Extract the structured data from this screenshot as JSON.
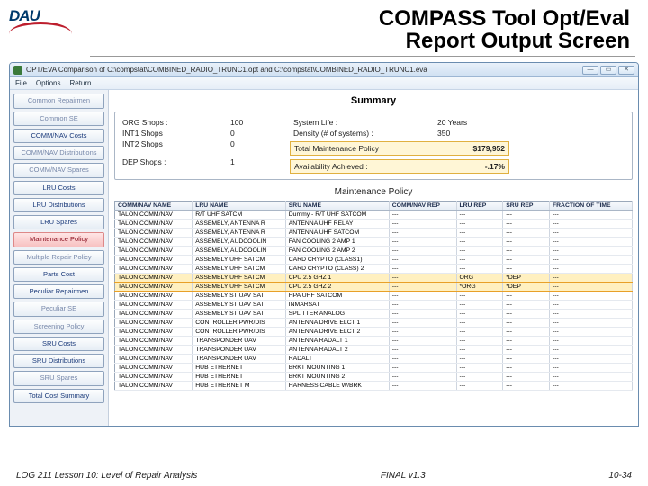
{
  "slide": {
    "title_line1": "COMPASS Tool Opt/Eval",
    "title_line2": "Report Output Screen",
    "logo_text": "DAU"
  },
  "window": {
    "title": "OPT/EVA Comparison of C:\\compstat\\COMBINED_RADIO_TRUNC1.opt and C:\\compstat\\COMBINED_RADIO_TRUNC1.eva"
  },
  "menu": {
    "file": "File",
    "options": "Options",
    "return": "Return"
  },
  "sidebar": {
    "items": [
      {
        "label": "Common Repairmen",
        "dim": true
      },
      {
        "label": "Common SE",
        "dim": true
      },
      {
        "label": "COMM/NAV Costs"
      },
      {
        "label": "COMM/NAV Distributions",
        "dim": true
      },
      {
        "label": "COMM/NAV Spares",
        "dim": true
      },
      {
        "label": "LRU Costs"
      },
      {
        "label": "LRU Distributions"
      },
      {
        "label": "LRU Spares"
      },
      {
        "label": "Maintenance Policy",
        "active": true
      },
      {
        "label": "Multiple Repair Policy",
        "dim": true
      },
      {
        "label": "Parts Cost"
      },
      {
        "label": "Peculiar Repairmen"
      },
      {
        "label": "Peculiar SE",
        "dim": true
      },
      {
        "label": "Screening Policy",
        "dim": true
      },
      {
        "label": "SRU Costs"
      },
      {
        "label": "SRU Distributions"
      },
      {
        "label": "SRU Spares",
        "dim": true
      },
      {
        "label": "Total Cost Summary"
      }
    ]
  },
  "summary": {
    "heading": "Summary",
    "rows": [
      {
        "l1": "ORG Shops :",
        "v1": "100",
        "l2": "System Life :",
        "v2": "20 Years"
      },
      {
        "l1": "INT1 Shops :",
        "v1": "0",
        "l2": "Density (# of systems) :",
        "v2": "350"
      },
      {
        "l1": "INT2 Shops :",
        "v1": "0"
      },
      {
        "l1": "DEP Shops :",
        "v1": "1"
      }
    ],
    "hl1": {
      "label": "Total Maintenance Policy :",
      "value": "$179,952"
    },
    "hl2": {
      "label": "Availability Achieved :",
      "value": "-.17%"
    }
  },
  "policy": {
    "heading": "Maintenance Policy",
    "headers": [
      "COMM/NAV NAME",
      "LRU NAME",
      "SRU NAME",
      "COMM/NAV REP",
      "LRU REP",
      "SRU REP",
      "FRACTION OF TIME"
    ],
    "rows": [
      {
        "c": [
          "TALON COMM/NAV",
          "R/T UHF SATCM",
          "Dummy - R/T UHF SATCOM",
          "---",
          "---",
          "---",
          "---"
        ]
      },
      {
        "c": [
          "TALON COMM/NAV",
          "ASSEMBLY, ANTENNA R",
          "ANTENNA UHF RELAY",
          "---",
          "---",
          "---",
          "---"
        ]
      },
      {
        "c": [
          "TALON COMM/NAV",
          "ASSEMBLY, ANTENNA R",
          "ANTENNA UHF SATCOM",
          "---",
          "---",
          "---",
          "---"
        ]
      },
      {
        "c": [
          "TALON COMM/NAV",
          "ASSEMBLY, AUDCOOLIN",
          "FAN COOLING 2 AMP 1",
          "---",
          "---",
          "---",
          "---"
        ]
      },
      {
        "c": [
          "TALON COMM/NAV",
          "ASSEMBLY, AUDCOOLIN",
          "FAN COOLING 2 AMP 2",
          "---",
          "---",
          "---",
          "---"
        ]
      },
      {
        "c": [
          "TALON COMM/NAV",
          "ASSEMBLY UHF SATCM",
          "CARD CRYPTO (CLASS1)",
          "---",
          "---",
          "---",
          "---"
        ]
      },
      {
        "c": [
          "TALON COMM/NAV",
          "ASSEMBLY UHF SATCM",
          "CARD CRYPTO (CLASS) 2",
          "---",
          "---",
          "---",
          "---"
        ]
      },
      {
        "c": [
          "TALON COMM/NAV",
          "ASSEMBLY UHF SATCM",
          "CPU 2.5 GHZ 1",
          "---",
          "ORG",
          "*DEP",
          "---"
        ],
        "hl": true
      },
      {
        "c": [
          "TALON COMM/NAV",
          "ASSEMBLY UHF SATCM",
          "CPU 2.5 GHZ 2",
          "---",
          "*ORG",
          "*DEP",
          "---"
        ],
        "hl": true
      },
      {
        "c": [
          "TALON COMM/NAV",
          "ASSEMBLY ST UAV SAT",
          "HPA UHF SATCOM",
          "---",
          "---",
          "---",
          "---"
        ]
      },
      {
        "c": [
          "TALON COMM/NAV",
          "ASSEMBLY ST UAV SAT",
          "INMARSAT",
          "---",
          "---",
          "---",
          "---"
        ]
      },
      {
        "c": [
          "TALON COMM/NAV",
          "ASSEMBLY ST UAV SAT",
          "SPLITTER ANALOG",
          "---",
          "---",
          "---",
          "---"
        ]
      },
      {
        "c": [
          "TALON COMM/NAV",
          "CONTROLLER PWR/DIS",
          "ANTENNA DRIVE ELCT 1",
          "---",
          "---",
          "---",
          "---"
        ]
      },
      {
        "c": [
          "TALON COMM/NAV",
          "CONTROLLER PWR/DIS",
          "ANTENNA DRIVE ELCT 2",
          "---",
          "---",
          "---",
          "---"
        ]
      },
      {
        "c": [
          "TALON COMM/NAV",
          "TRANSPONDER UAV",
          "ANTENNA RADALT 1",
          "---",
          "---",
          "---",
          "---"
        ]
      },
      {
        "c": [
          "TALON COMM/NAV",
          "TRANSPONDER UAV",
          "ANTENNA RADALT 2",
          "---",
          "---",
          "---",
          "---"
        ]
      },
      {
        "c": [
          "TALON COMM/NAV",
          "TRANSPONDER UAV",
          "RADALT",
          "---",
          "---",
          "---",
          "---"
        ]
      },
      {
        "c": [
          "TALON COMM/NAV",
          "HUB ETHERNET",
          "BRKT MOUNTING 1",
          "---",
          "---",
          "---",
          "---"
        ]
      },
      {
        "c": [
          "TALON COMM/NAV",
          "HUB ETHERNET",
          "BRKT MOUNTING 2",
          "---",
          "---",
          "---",
          "---"
        ]
      },
      {
        "c": [
          "TALON COMM/NAV",
          "HUB ETHERNET M",
          "HARNESS CABLE W/BRK",
          "---",
          "---",
          "---",
          "---"
        ]
      }
    ]
  },
  "footer": {
    "left": "LOG 211 Lesson 10: Level of Repair Analysis",
    "center": "FINAL v1.3",
    "right": "10-34"
  }
}
